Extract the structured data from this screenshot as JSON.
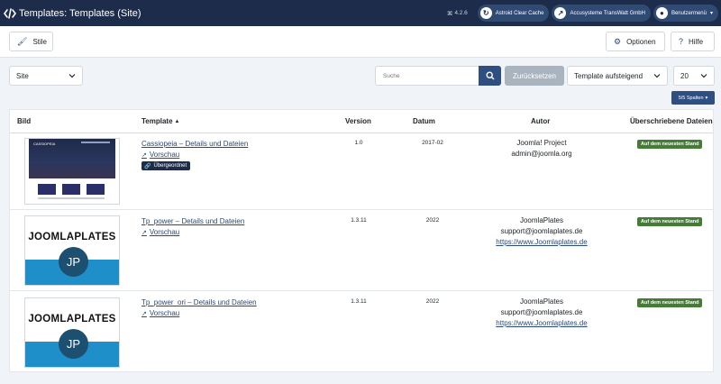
{
  "header": {
    "title": "Templates: Templates (Site)",
    "version": "4.2.6",
    "buttons": [
      {
        "label": "Astroid Clear Cache",
        "icon": "refresh-icon"
      },
      {
        "label": "Accusysteme TransWatt GmbH",
        "icon": "external-link-icon"
      },
      {
        "label": "Benutzermenü",
        "icon": "user-icon"
      }
    ]
  },
  "toolbar": {
    "styles_label": "Stile",
    "options_label": "Optionen",
    "help_label": "Hilfe"
  },
  "filters": {
    "client_value": "Site",
    "search_placeholder": "Suche",
    "reset_label": "Zurücksetzen",
    "sort_value": "Template aufsteigend",
    "limit_value": "20",
    "columns_label": "5/5 Spalten"
  },
  "table": {
    "headers": {
      "image": "Bild",
      "template": "Template",
      "version": "Version",
      "date": "Datum",
      "author": "Autor",
      "overrides": "Überschriebene Dateien"
    },
    "rows": [
      {
        "template_link": "Cassiopeia – Details und Dateien",
        "preview_label": "Vorschau",
        "parent_badge": "Übergeordnet",
        "version": "1.0",
        "date": "2017-02",
        "author_name": "Joomla! Project",
        "author_email": "admin@joomla.org",
        "author_url": "",
        "status": "Auf dem neuesten Stand",
        "thumb_title": "CASSIOPEIA"
      },
      {
        "template_link": "Tp_power – Details und Dateien",
        "preview_label": "Vorschau",
        "version": "1.3.11",
        "date": "2022",
        "author_name": "JoomlaPlates",
        "author_email": "support@joomlaplates.de",
        "author_url": "https://www.Joomlaplates.de",
        "status": "Auf dem neuesten Stand",
        "thumb_title": "JOOMLAPLATES",
        "thumb_initials": "JP"
      },
      {
        "template_link": "Tp_power_ori – Details und Dateien",
        "preview_label": "Vorschau",
        "version": "1.3.11",
        "date": "2022",
        "author_name": "JoomlaPlates",
        "author_email": "support@joomlaplates.de",
        "author_url": "https://www.Joomlaplates.de",
        "status": "Auf dem neuesten Stand",
        "thumb_title": "JOOMLAPLATES",
        "thumb_initials": "JP"
      }
    ]
  },
  "colors": {
    "header_bg": "#1c2c4a",
    "primary": "#2f4f82",
    "link": "#2a4a7a",
    "success": "#457d36"
  }
}
